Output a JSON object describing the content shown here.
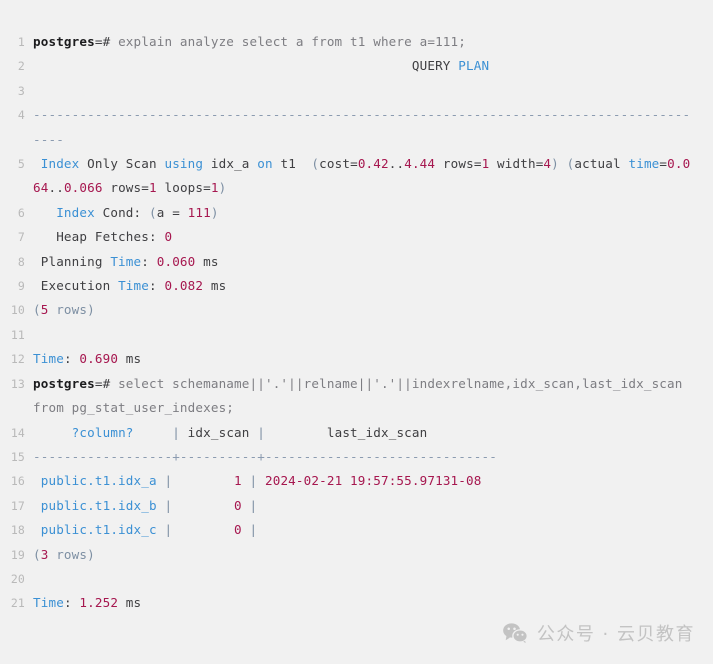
{
  "window": {
    "kind": "terminal-code-block",
    "background_color": "#f1f1f1",
    "gutter_color": "#b9b9b9",
    "default_text_color": "#3f3f42"
  },
  "palette": {
    "keyword_blue": "#3b90d4",
    "number_magenta": "#a6174f",
    "punct_blue_gray": "#7d8fa3",
    "dash_gray": "#8b9bb0",
    "prompt_dark": "#1c1c1e",
    "dim_gray": "#7d7d82",
    "watermark_gray": "#c3c3c3"
  },
  "lines": [
    {
      "n": "1",
      "text": "postgres=# explain analyze select a from t1 where a=111;"
    },
    {
      "n": "2",
      "text": "                                                 QUERY PLAN"
    },
    {
      "n": "3",
      "text": ""
    },
    {
      "n": "4",
      "text": "-----------------------------------------------------------------------------------------"
    },
    {
      "n": "5",
      "text": " Index Only Scan using idx_a on t1  (cost=0.42..4.44 rows=1 width=4) (actual time=0.064..0.066 rows=1 loops=1)"
    },
    {
      "n": "6",
      "text": "   Index Cond: (a = 111)"
    },
    {
      "n": "7",
      "text": "   Heap Fetches: 0"
    },
    {
      "n": "8",
      "text": " Planning Time: 0.060 ms"
    },
    {
      "n": "9",
      "text": " Execution Time: 0.082 ms"
    },
    {
      "n": "10",
      "text": "(5 rows)"
    },
    {
      "n": "11",
      "text": ""
    },
    {
      "n": "12",
      "text": "Time: 0.690 ms"
    },
    {
      "n": "13",
      "text": "postgres=# select schemaname||'.'||relname||'.'||indexrelname,idx_scan,last_idx_scan from pg_stat_user_indexes;"
    },
    {
      "n": "14",
      "text": "     ?column?     | idx_scan |        last_idx_scan"
    },
    {
      "n": "15",
      "text": "------------------+----------+------------------------------"
    },
    {
      "n": "16",
      "text": " public.t1.idx_a |        1 | 2024-02-21 19:57:55.97131-08"
    },
    {
      "n": "17",
      "text": " public.t1.idx_b |        0 |"
    },
    {
      "n": "18",
      "text": " public.t1.idx_c |        0 |"
    },
    {
      "n": "19",
      "text": "(3 rows)"
    },
    {
      "n": "20",
      "text": ""
    },
    {
      "n": "21",
      "text": "Time: 1.252 ms"
    }
  ],
  "tokens": {
    "line1": {
      "prompt": "postgres",
      "prompt_sep": "=# ",
      "command": "explain analyze select a from t1 where a=111;"
    },
    "line2": {
      "indent": "                                                 ",
      "query": "QUERY",
      "space": " ",
      "plan": "PLAN"
    },
    "line4": {
      "dashes": "-----------------------------------------------------------------------------------------"
    },
    "line5": {
      "a_index": " Index",
      "b_onlyscan": " Only Scan ",
      "c_using": "using",
      "d_idx": " idx_a ",
      "e_on": "on",
      "f_t1": " t1  ",
      "g_paren1": "(",
      "h_cost": "cost=",
      "i_costval": "0.42",
      "j_dots": "..",
      "k_costval2": "4.44",
      "l_rows": " rows=",
      "m_rowsval": "1",
      "n_width": " width=",
      "o_widthval": "4",
      "p_paren2": ")",
      "q_sp": " ",
      "r_paren3": "(",
      "s_actual": "actual ",
      "t_time": "time",
      "u_eq": "=",
      "v_t1val": "0.064",
      "w_dots": "..",
      "x_t2val": "0.066",
      "y_rows": " rows=",
      "z_rowsval": "1",
      "aa_loops": " loops=",
      "ab_loopsval": "1",
      "ac_paren4": ")"
    },
    "line6": {
      "index": "   Index",
      "cond": " Cond: ",
      "paren1": "(",
      "expr": "a = ",
      "num": "111",
      "paren2": ")"
    },
    "line7": {
      "label": "   Heap Fetches: ",
      "value": "0"
    },
    "line8": {
      "planning": " Planning ",
      "time": "Time",
      "colon": ": ",
      "value": "0.060",
      "unit": " ms"
    },
    "line9": {
      "execution": " Execution ",
      "time": "Time",
      "colon": ": ",
      "value": "0.082",
      "unit": " ms"
    },
    "line10": {
      "paren1": "(",
      "num": "5",
      "word": " rows",
      "paren2": ")"
    },
    "line12": {
      "time": "Time",
      "colon": ": ",
      "value": "0.690",
      "unit": " ms"
    },
    "line13": {
      "prompt": "postgres",
      "prompt_sep": "=# ",
      "command": "select schemaname||'.'||relname||'.'||indexrelname,idx_scan,last_idx_scan from pg_stat_user_indexes;"
    },
    "line14": {
      "pad1": "     ",
      "col1": "?column?",
      "pad2": "     ",
      "pipe1": "|",
      "col2": " idx_scan ",
      "pipe2": "|",
      "pad3": "        ",
      "col3": "last_idx_scan"
    },
    "line15": {
      "d1": "------------------",
      "p1": "+",
      "d2": "----------",
      "p2": "+",
      "d3": "------------------------------"
    },
    "line16": {
      "name": " public.t1.idx_a ",
      "pipe1": "|",
      "pad": "        ",
      "scan": "1",
      "sp": " ",
      "pipe2": "|",
      "ts": " 2024-02-21 19:57:55.97131-08"
    },
    "line17": {
      "name": " public.t1.idx_b ",
      "pipe1": "|",
      "pad": "        ",
      "scan": "0",
      "sp": " ",
      "pipe2": "|"
    },
    "line18": {
      "name": " public.t1.idx_c ",
      "pipe1": "|",
      "pad": "        ",
      "scan": "0",
      "sp": " ",
      "pipe2": "|"
    },
    "line19": {
      "paren1": "(",
      "num": "3",
      "word": " rows",
      "paren2": ")"
    },
    "line21": {
      "time": "Time",
      "colon": ": ",
      "value": "1.252",
      "unit": " ms"
    }
  },
  "gutter_numbers": [
    "1",
    "2",
    "3",
    "4",
    "5",
    "6",
    "7",
    "8",
    "9",
    "10",
    "11",
    "12",
    "13",
    "14",
    "15",
    "16",
    "17",
    "18",
    "19",
    "20",
    "21"
  ],
  "watermark": {
    "icon": "wechat-icon",
    "text": "公众号 · 云贝教育"
  }
}
